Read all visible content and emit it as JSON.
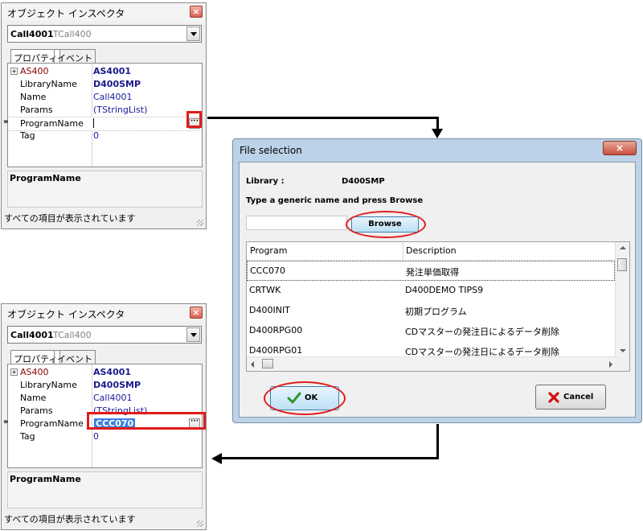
{
  "inspector": {
    "title": "オブジェクト インスペクタ",
    "close_glyph": "×",
    "object_name": "Call4001",
    "object_class": "TCall400",
    "tabs": [
      {
        "label": "プロパティ"
      },
      {
        "label": "イベント"
      }
    ],
    "properties_before": [
      {
        "key": "AS400",
        "value": "AS4001"
      },
      {
        "key": "LibraryName",
        "value": "D400SMP"
      },
      {
        "key": "Name",
        "value": "Call4001"
      },
      {
        "key": "Params",
        "value": "(TStringList)"
      },
      {
        "key": "ProgramName",
        "value": ""
      },
      {
        "key": "Tag",
        "value": "0"
      }
    ],
    "properties_after": [
      {
        "key": "AS400",
        "value": "AS4001"
      },
      {
        "key": "LibraryName",
        "value": "D400SMP"
      },
      {
        "key": "Name",
        "value": "Call4001"
      },
      {
        "key": "Params",
        "value": "(TStringList)"
      },
      {
        "key": "ProgramName",
        "value": "CCC070"
      },
      {
        "key": "Tag",
        "value": "0"
      }
    ],
    "expand_glyph": "+",
    "row_marker": "»",
    "ellipsis_glyph": "···",
    "help_title": "ProgramName",
    "status": "すべての項目が表示されています"
  },
  "dialog": {
    "title": "File selection",
    "close_glyph": "×",
    "library_label": "Library :",
    "library_value": "D400SMP",
    "instruction": "Type a generic name and press Browse",
    "browse_label": "Browse",
    "columns": [
      "Program",
      "Description"
    ],
    "rows": [
      {
        "program": "CCC070",
        "description": "発注単価取得"
      },
      {
        "program": "CRTWK",
        "description": "D400DEMO TIPS9"
      },
      {
        "program": "D400INIT",
        "description": "初期プログラム"
      },
      {
        "program": "D400RPG00",
        "description": "CDマスターの発注日によるデータ削除"
      },
      {
        "program": "D400RPG01",
        "description": "CDマスターの発注日によるデータ削除"
      }
    ],
    "ok_label": "OK",
    "cancel_label": "Cancel",
    "colors": {
      "highlight": "#e21b1b",
      "ok_check": "#2a9a2a",
      "cancel_x": "#d01010"
    }
  }
}
